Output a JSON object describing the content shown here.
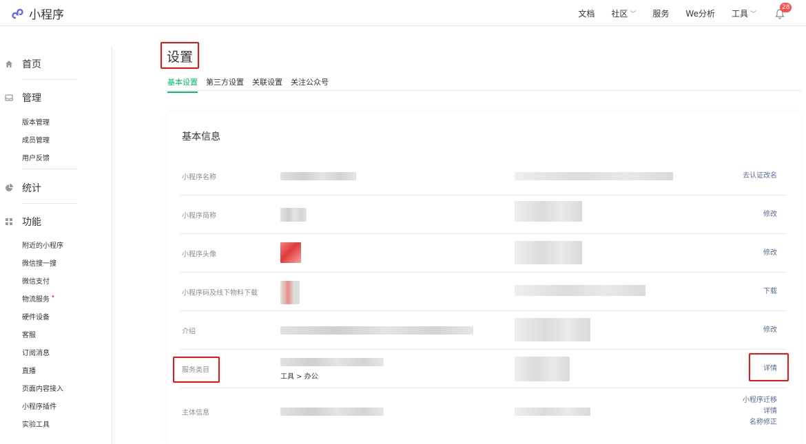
{
  "app": {
    "title": "小程序"
  },
  "topnav": {
    "items": [
      {
        "label": "文档",
        "dropdown": false
      },
      {
        "label": "社区",
        "dropdown": true
      },
      {
        "label": "服务",
        "dropdown": false
      },
      {
        "label": "We分析",
        "dropdown": false
      },
      {
        "label": "工具",
        "dropdown": true
      }
    ],
    "notifications": "28"
  },
  "sidebar": {
    "home": "首页",
    "manage": {
      "label": "管理",
      "items": [
        "版本管理",
        "成员管理",
        "用户反馈"
      ]
    },
    "stats": "统计",
    "features": {
      "label": "功能",
      "items": [
        "附近的小程序",
        "微信搜一搜",
        "微信支付",
        "物流服务",
        "硬件设备",
        "客服",
        "订阅消息",
        "直播",
        "页面内容接入",
        "小程序插件",
        "实验工具"
      ],
      "new_dot_item": "物流服务"
    }
  },
  "page": {
    "title": "设置",
    "tabs": [
      "基本设置",
      "第三方设置",
      "关联设置",
      "关注公众号"
    ],
    "active_tab": "基本设置"
  },
  "basic_info": {
    "title": "基本信息",
    "rows": [
      {
        "label": "小程序名称",
        "actions": [
          "去认证改名"
        ]
      },
      {
        "label": "小程序简称",
        "actions": [
          "修改"
        ]
      },
      {
        "label": "小程序头像",
        "actions": [
          "修改"
        ]
      },
      {
        "label": "小程序码及线下物料下载",
        "actions": [
          "下载"
        ]
      },
      {
        "label": "介绍",
        "actions": [
          "修改"
        ]
      },
      {
        "label": "服务类目",
        "value": "工具 > 办公",
        "actions": [
          "详情"
        ]
      },
      {
        "label": "主体信息",
        "actions": [
          "小程序迁移",
          "详情",
          "名称修正"
        ]
      }
    ]
  },
  "colors": {
    "accent": "#07c160",
    "link": "#576b95",
    "highlight": "#e11111",
    "badge": "#fa5151"
  }
}
